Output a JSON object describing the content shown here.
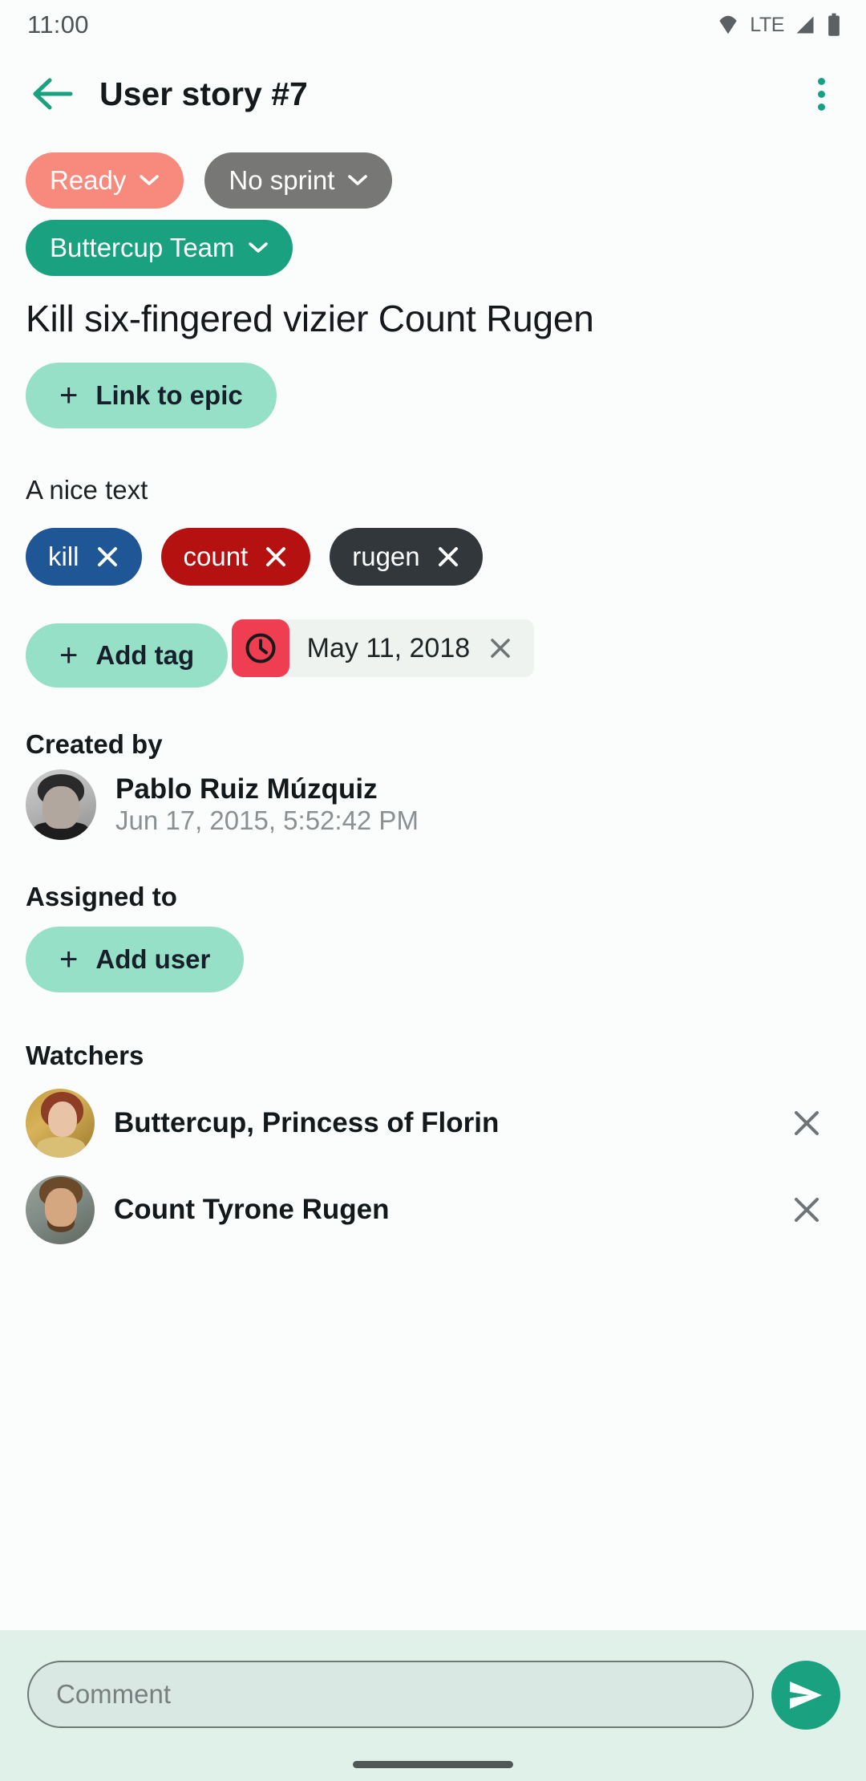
{
  "status_bar": {
    "time": "11:00",
    "network_label": "LTE",
    "icons": [
      "wifi-icon",
      "signal-icon",
      "battery-icon"
    ]
  },
  "app_bar": {
    "back_icon": "arrow-left-icon",
    "title": "User story #7",
    "overflow_icon": "more-vertical-icon",
    "accent_color": "#1aa180"
  },
  "chips": [
    {
      "label": "Ready",
      "color": "#f8897d",
      "caret": "chevron-down-icon",
      "name": "status-chip"
    },
    {
      "label": "No sprint",
      "color": "#777776",
      "caret": "chevron-down-icon",
      "name": "sprint-chip"
    },
    {
      "label": "Buttercup Team",
      "color": "#1aa180",
      "caret": "chevron-down-icon",
      "name": "team-chip"
    }
  ],
  "story": {
    "title": "Kill six-fingered vizier Count Rugen",
    "link_epic_label": "Link to epic",
    "description": "A nice text"
  },
  "tags": [
    {
      "label": "kill",
      "color": "#1f5695"
    },
    {
      "label": "count",
      "color": "#b61111"
    },
    {
      "label": "rugen",
      "color": "#31373a"
    }
  ],
  "add_tag_label": "Add tag",
  "due_date": {
    "icon": "clock-icon",
    "icon_bg": "#ef3d52",
    "value": "May 11, 2018",
    "remove_icon": "close-icon"
  },
  "created_by": {
    "section_label": "Created by",
    "name": "Pablo Ruiz Múzquiz",
    "timestamp": "Jun 17, 2015, 5:52:42 PM",
    "avatar": "avatar-pablo"
  },
  "assigned_to": {
    "section_label": "Assigned to",
    "add_user_label": "Add user"
  },
  "watchers": {
    "section_label": "Watchers",
    "items": [
      {
        "name": "Buttercup, Princess of Florin",
        "avatar": "avatar-buttercup",
        "remove_icon": "close-icon"
      },
      {
        "name": "Count Tyrone Rugen",
        "avatar": "avatar-rugen",
        "remove_icon": "close-icon"
      }
    ]
  },
  "comment_bar": {
    "placeholder": "Comment",
    "value": "",
    "send_icon": "send-icon",
    "send_color": "#1aa180",
    "background": "#e0f1ea"
  }
}
